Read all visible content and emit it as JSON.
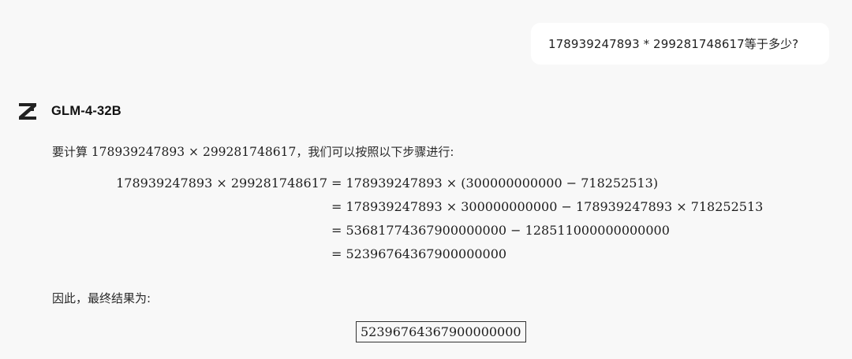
{
  "user_message": "178939247893 * 299281748617等于多少?",
  "model": {
    "name": "GLM-4-32B",
    "logo_icon": "zhipu-z-logo-icon"
  },
  "response": {
    "intro_prefix": "要计算 ",
    "intro_math": "178939247893 × 299281748617",
    "intro_suffix": "，我们可以按照以下步骤进行:",
    "equations": [
      {
        "lhs": "178939247893 × 299281748617",
        "rhs": "= 178939247893 × (300000000000 − 718252513)"
      },
      {
        "lhs": "",
        "rhs": "= 178939247893 × 300000000000 − 178939247893 × 718252513"
      },
      {
        "lhs": "",
        "rhs": "= 53681774367900000000 − 128511000000000000"
      },
      {
        "lhs": "",
        "rhs": "= 52396764367900000000"
      }
    ],
    "conclusion": "因此，最终结果为:",
    "answer": "52396764367900000000"
  }
}
